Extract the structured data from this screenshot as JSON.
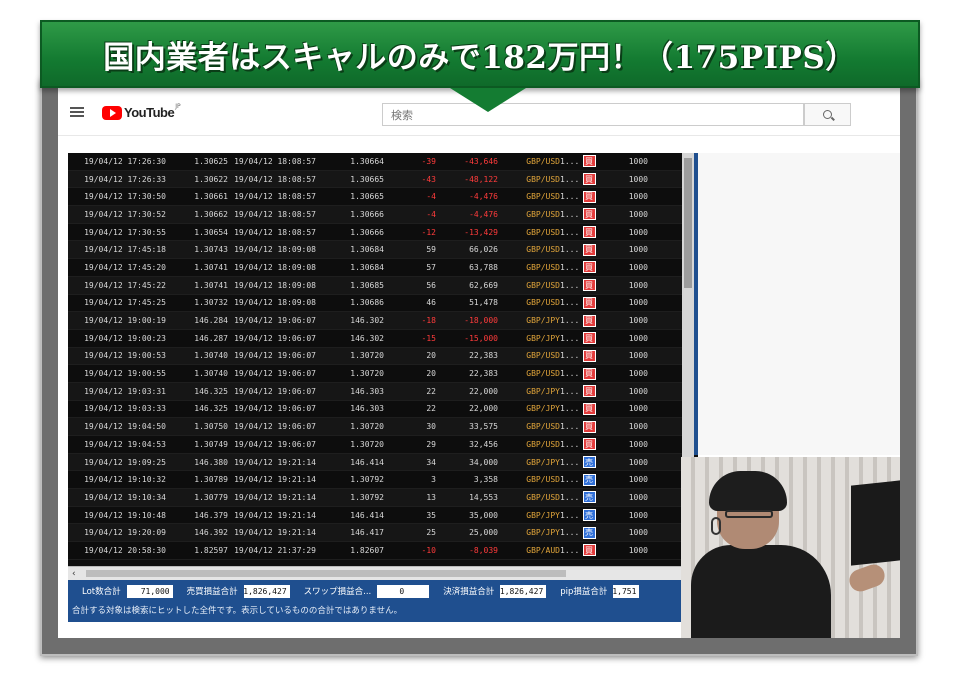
{
  "banner": {
    "title": "国内業者はスキャルのみで182万円！（175PIPS）",
    "color": "#147c32"
  },
  "youtube": {
    "logo": "YouTube",
    "region": "JP",
    "search_placeholder": "検索"
  },
  "trades": [
    {
      "open_time": "19/04/12 17:26:30",
      "open_rate": "1.30625",
      "close_time": "19/04/12 18:08:57",
      "close_rate": "1.30664",
      "pips": "-39",
      "profit": "-43,646",
      "pair": "GBP/USD",
      "flag": "1...",
      "side": "買",
      "lots": "1000"
    },
    {
      "open_time": "19/04/12 17:26:33",
      "open_rate": "1.30622",
      "close_time": "19/04/12 18:08:57",
      "close_rate": "1.30665",
      "pips": "-43",
      "profit": "-48,122",
      "pair": "GBP/USD",
      "flag": "1...",
      "side": "買",
      "lots": "1000"
    },
    {
      "open_time": "19/04/12 17:30:50",
      "open_rate": "1.30661",
      "close_time": "19/04/12 18:08:57",
      "close_rate": "1.30665",
      "pips": "-4",
      "profit": "-4,476",
      "pair": "GBP/USD",
      "flag": "1...",
      "side": "買",
      "lots": "1000"
    },
    {
      "open_time": "19/04/12 17:30:52",
      "open_rate": "1.30662",
      "close_time": "19/04/12 18:08:57",
      "close_rate": "1.30666",
      "pips": "-4",
      "profit": "-4,476",
      "pair": "GBP/USD",
      "flag": "1...",
      "side": "買",
      "lots": "1000"
    },
    {
      "open_time": "19/04/12 17:30:55",
      "open_rate": "1.30654",
      "close_time": "19/04/12 18:08:57",
      "close_rate": "1.30666",
      "pips": "-12",
      "profit": "-13,429",
      "pair": "GBP/USD",
      "flag": "1...",
      "side": "買",
      "lots": "1000"
    },
    {
      "open_time": "19/04/12 17:45:18",
      "open_rate": "1.30743",
      "close_time": "19/04/12 18:09:08",
      "close_rate": "1.30684",
      "pips": "59",
      "profit": "66,026",
      "pair": "GBP/USD",
      "flag": "1...",
      "side": "買",
      "lots": "1000"
    },
    {
      "open_time": "19/04/12 17:45:20",
      "open_rate": "1.30741",
      "close_time": "19/04/12 18:09:08",
      "close_rate": "1.30684",
      "pips": "57",
      "profit": "63,788",
      "pair": "GBP/USD",
      "flag": "1...",
      "side": "買",
      "lots": "1000"
    },
    {
      "open_time": "19/04/12 17:45:22",
      "open_rate": "1.30741",
      "close_time": "19/04/12 18:09:08",
      "close_rate": "1.30685",
      "pips": "56",
      "profit": "62,669",
      "pair": "GBP/USD",
      "flag": "1...",
      "side": "買",
      "lots": "1000"
    },
    {
      "open_time": "19/04/12 17:45:25",
      "open_rate": "1.30732",
      "close_time": "19/04/12 18:09:08",
      "close_rate": "1.30686",
      "pips": "46",
      "profit": "51,478",
      "pair": "GBP/USD",
      "flag": "1...",
      "side": "買",
      "lots": "1000"
    },
    {
      "open_time": "19/04/12 19:00:19",
      "open_rate": "146.284",
      "close_time": "19/04/12 19:06:07",
      "close_rate": "146.302",
      "pips": "-18",
      "profit": "-18,000",
      "pair": "GBP/JPY",
      "flag": "1...",
      "side": "買",
      "lots": "1000"
    },
    {
      "open_time": "19/04/12 19:00:23",
      "open_rate": "146.287",
      "close_time": "19/04/12 19:06:07",
      "close_rate": "146.302",
      "pips": "-15",
      "profit": "-15,000",
      "pair": "GBP/JPY",
      "flag": "1...",
      "side": "買",
      "lots": "1000"
    },
    {
      "open_time": "19/04/12 19:00:53",
      "open_rate": "1.30740",
      "close_time": "19/04/12 19:06:07",
      "close_rate": "1.30720",
      "pips": "20",
      "profit": "22,383",
      "pair": "GBP/USD",
      "flag": "1...",
      "side": "買",
      "lots": "1000"
    },
    {
      "open_time": "19/04/12 19:00:55",
      "open_rate": "1.30740",
      "close_time": "19/04/12 19:06:07",
      "close_rate": "1.30720",
      "pips": "20",
      "profit": "22,383",
      "pair": "GBP/USD",
      "flag": "1...",
      "side": "買",
      "lots": "1000"
    },
    {
      "open_time": "19/04/12 19:03:31",
      "open_rate": "146.325",
      "close_time": "19/04/12 19:06:07",
      "close_rate": "146.303",
      "pips": "22",
      "profit": "22,000",
      "pair": "GBP/JPY",
      "flag": "1...",
      "side": "買",
      "lots": "1000"
    },
    {
      "open_time": "19/04/12 19:03:33",
      "open_rate": "146.325",
      "close_time": "19/04/12 19:06:07",
      "close_rate": "146.303",
      "pips": "22",
      "profit": "22,000",
      "pair": "GBP/JPY",
      "flag": "1...",
      "side": "買",
      "lots": "1000"
    },
    {
      "open_time": "19/04/12 19:04:50",
      "open_rate": "1.30750",
      "close_time": "19/04/12 19:06:07",
      "close_rate": "1.30720",
      "pips": "30",
      "profit": "33,575",
      "pair": "GBP/USD",
      "flag": "1...",
      "side": "買",
      "lots": "1000"
    },
    {
      "open_time": "19/04/12 19:04:53",
      "open_rate": "1.30749",
      "close_time": "19/04/12 19:06:07",
      "close_rate": "1.30720",
      "pips": "29",
      "profit": "32,456",
      "pair": "GBP/USD",
      "flag": "1...",
      "side": "買",
      "lots": "1000"
    },
    {
      "open_time": "19/04/12 19:09:25",
      "open_rate": "146.380",
      "close_time": "19/04/12 19:21:14",
      "close_rate": "146.414",
      "pips": "34",
      "profit": "34,000",
      "pair": "GBP/JPY",
      "flag": "1...",
      "side": "売",
      "lots": "1000"
    },
    {
      "open_time": "19/04/12 19:10:32",
      "open_rate": "1.30789",
      "close_time": "19/04/12 19:21:14",
      "close_rate": "1.30792",
      "pips": "3",
      "profit": "3,358",
      "pair": "GBP/USD",
      "flag": "1...",
      "side": "売",
      "lots": "1000"
    },
    {
      "open_time": "19/04/12 19:10:34",
      "open_rate": "1.30779",
      "close_time": "19/04/12 19:21:14",
      "close_rate": "1.30792",
      "pips": "13",
      "profit": "14,553",
      "pair": "GBP/USD",
      "flag": "1...",
      "side": "売",
      "lots": "1000"
    },
    {
      "open_time": "19/04/12 19:10:48",
      "open_rate": "146.379",
      "close_time": "19/04/12 19:21:14",
      "close_rate": "146.414",
      "pips": "35",
      "profit": "35,000",
      "pair": "GBP/JPY",
      "flag": "1...",
      "side": "売",
      "lots": "1000"
    },
    {
      "open_time": "19/04/12 19:20:09",
      "open_rate": "146.392",
      "close_time": "19/04/12 19:21:14",
      "close_rate": "146.417",
      "pips": "25",
      "profit": "25,000",
      "pair": "GBP/JPY",
      "flag": "1...",
      "side": "売",
      "lots": "1000"
    },
    {
      "open_time": "19/04/12 20:58:30",
      "open_rate": "1.82597",
      "close_time": "19/04/12 21:37:29",
      "close_rate": "1.82607",
      "pips": "-10",
      "profit": "-8,039",
      "pair": "GBP/AUD",
      "flag": "1...",
      "side": "買",
      "lots": "1000"
    }
  ],
  "summary": {
    "lot_label": "Lot数合計",
    "lot_value": "71,000",
    "pl_label": "売買損益合計",
    "pl_value": "1,826,427",
    "swap_label": "スワップ損益合...",
    "swap_value": "0",
    "settle_label": "決済損益合計",
    "settle_value": "1,826,427",
    "pip_label": "pip損益合計",
    "pip_value": "1,751",
    "note": "合計する対象は検索にヒットした全件です。表示しているものの合計ではありません。"
  },
  "colors": {
    "buy": "#e33b3b",
    "sell": "#2f6fd8",
    "pair": "#e0a43a",
    "negative": "#ff3b3b",
    "footer": "#1f4f8f"
  }
}
